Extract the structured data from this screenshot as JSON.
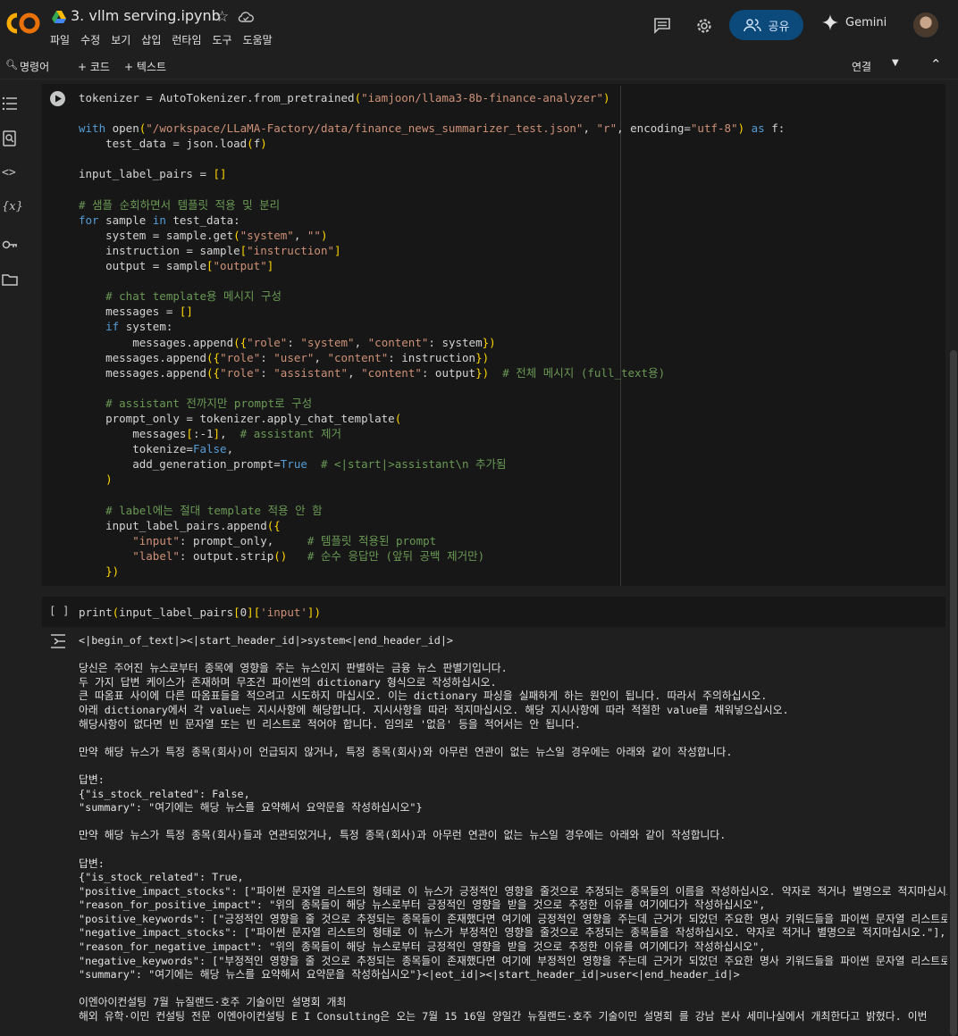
{
  "header": {
    "title": "3. vllm serving.ipynb",
    "menu": [
      "파일",
      "수정",
      "보기",
      "삽입",
      "런타임",
      "도구",
      "도움말"
    ],
    "share_label": "공유",
    "gemini_label": "Gemini"
  },
  "toolbar": {
    "command_label": "명령어",
    "add_code_label": "+ 코드",
    "add_text_label": "+ 텍스트",
    "connect_label": "연결"
  },
  "cells": [
    {
      "type": "code",
      "exec_marker": "",
      "lines": [
        "tokenizer = AutoTokenizer.from_pretrained(\"iamjoon/llama3-8b-finance-analyzer\")",
        "",
        "with open(\"/workspace/LLaMA-Factory/data/finance_news_summarizer_test.json\", \"r\", encoding=\"utf-8\") as f:",
        "    test_data = json.load(f)",
        "",
        "input_label_pairs = []",
        "",
        "# 샘플 순회하면서 템플릿 적용 및 분리",
        "for sample in test_data:",
        "    system = sample.get(\"system\", \"\")",
        "    instruction = sample[\"instruction\"]",
        "    output = sample[\"output\"]",
        "",
        "    # chat template용 메시지 구성",
        "    messages = []",
        "    if system:",
        "        messages.append({\"role\": \"system\", \"content\": system})",
        "    messages.append({\"role\": \"user\", \"content\": instruction})",
        "    messages.append({\"role\": \"assistant\", \"content\": output})  # 전체 메시지 (full_text용)",
        "",
        "    # assistant 전까지만 prompt로 구성",
        "    prompt_only = tokenizer.apply_chat_template(",
        "        messages[:-1],  # assistant 제거",
        "        tokenize=False,",
        "        add_generation_prompt=True  # <|start|>assistant\\n 추가됨",
        "    )",
        "",
        "    # label에는 절대 template 적용 안 함",
        "    input_label_pairs.append({",
        "        \"input\": prompt_only,     # 템플릿 적용된 prompt",
        "        \"label\": output.strip()   # 순수 응답만 (앞뒤 공백 제거만)",
        "    })"
      ]
    },
    {
      "type": "code",
      "exec_marker": "[ ]",
      "lines": [
        "print(input_label_pairs[0]['input'])"
      ],
      "output": [
        "<|begin_of_text|><|start_header_id|>system<|end_header_id|>",
        "",
        "당신은 주어진 뉴스로부터 종목에 영향을 주는 뉴스인지 판별하는 금융 뉴스 판별기입니다.",
        "두 가지 답변 케이스가 존재하며 무조건 파이썬의 dictionary 형식으로 작성하십시오.",
        "큰 따옴표 사이에 다른 따옴표들을 적으려고 시도하지 마십시오. 이는 dictionary 파싱을 실패하게 하는 원인이 됩니다. 따라서 주의하십시오.",
        "아래 dictionary에서 각 value는 지시사항에 해당합니다. 지시사항을 따라 적지마십시오. 해당 지시사항에 따라 적절한 value를 채워넣으십시오.",
        "해당사항이 없다면 빈 문자열 또는 빈 리스트로 적어야 합니다. 임의로 '없음' 등을 적어서는 안 됩니다.",
        "",
        "만약 해당 뉴스가 특정 종목(회사)이 언급되지 않거나, 특정 종목(회사)와 아무런 연관이 없는 뉴스일 경우에는 아래와 같이 작성합니다.",
        "",
        "답변:",
        "{\"is_stock_related\": False,",
        "\"summary\": \"여기에는 해당 뉴스를 요약해서 요약문을 작성하십시오\"}",
        "",
        "만약 해당 뉴스가 특정 종목(회사)들과 연관되었거나, 특정 종목(회사)과 아무런 연관이 없는 뉴스일 경우에는 아래와 같이 작성합니다.",
        "",
        "답변:",
        "{\"is_stock_related\": True,",
        "\"positive_impact_stocks\": [\"파이썬 문자열 리스트의 형태로 이 뉴스가 긍정적인 영향을 줄것으로 추정되는 종목들의 이름을 작성하십시오. 약자로 적거나 별명으로 적지마십시오.\"],",
        "\"reason_for_positive_impact\": \"위의 종목들이 해당 뉴스로부터 긍정적인 영향을 받을 것으로 추정한 이유를 여기에다가 작성하십시오\",",
        "\"positive_keywords\": [\"긍정적인 영향을 줄 것으로 추정되는 종목들이 존재했다면 여기에 긍정적인 영향을 주는데 근거가 되었던 주요한 명사 키워드들을 파이썬 문자열 리스트로 작성하십시오.\"],",
        "\"negative_impact_stocks\": [\"파이썬 문자열 리스트의 형태로 이 뉴스가 부정적인 영향을 줄것으로 추정되는 종목들을 작성하십시오. 약자로 적거나 별명으로 적지마십시오.\"],",
        "\"reason_for_negative_impact\": \"위의 종목들이 해당 뉴스로부터 긍정적인 영향을 받을 것으로 추정한 이유를 여기에다가 작성하십시오\",",
        "\"negative_keywords\": [\"부정적인 영향을 줄 것으로 추정되는 종목들이 존재했다면 여기에 부정적인 영향을 주는데 근거가 되었던 주요한 명사 키워드들을 파이썬 문자열 리스트로 작성하십시오.\"],",
        "\"summary\": \"여기에는 해당 뉴스를 요약해서 요약문을 작성하십시오\"}<|eot_id|><|start_header_id|>user<|end_header_id|>",
        "",
        "이엔아이컨설팅 7월 뉴질랜드·호주 기술이민 설명회 개최",
        "해외 유학·이민 컨설팅 전문 이엔아이컨설팅 E I Consulting은 오는 7월 15 16일 양일간 뉴질랜드·호주 기술이민 설명회 를 강남 본사 세미나실에서 개최한다고 밝혔다. 이번"
      ]
    }
  ]
}
